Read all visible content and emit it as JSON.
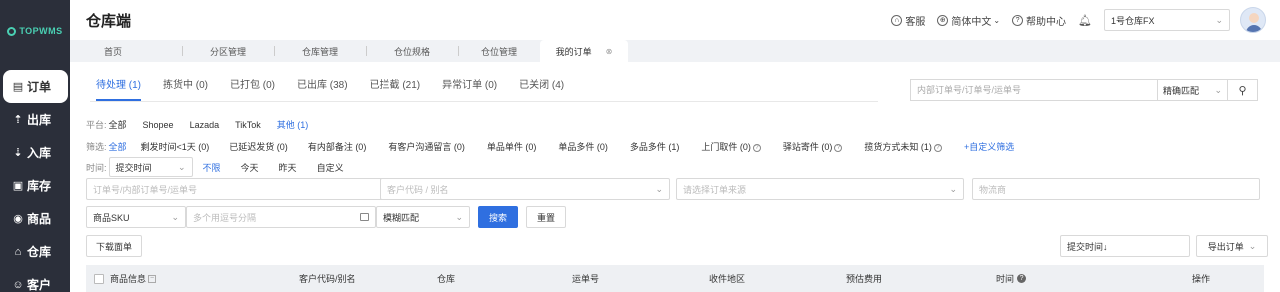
{
  "brand": {
    "logo_text": "TOPWMS",
    "accent": "#4ad0b3"
  },
  "sidebar": {
    "items": [
      {
        "label": "订单",
        "icon": "order-icon",
        "glyph": "▤",
        "active": true
      },
      {
        "label": "出库",
        "icon": "outbound-icon",
        "glyph": "⇡"
      },
      {
        "label": "入库",
        "icon": "inbound-icon",
        "glyph": "⇣"
      },
      {
        "label": "库存",
        "icon": "inventory-icon",
        "glyph": "▣"
      },
      {
        "label": "商品",
        "icon": "goods-icon",
        "glyph": "◉"
      },
      {
        "label": "仓库",
        "icon": "warehouse-icon",
        "glyph": "⌂"
      },
      {
        "label": "客户",
        "icon": "customer-icon",
        "glyph": "☺"
      }
    ]
  },
  "header": {
    "title": "仓库端",
    "service": "客服",
    "language": "简体中文",
    "help": "帮助中心",
    "warehouse": "1号仓库FX"
  },
  "page_tabs": [
    {
      "label": "首页"
    },
    {
      "label": "分区管理"
    },
    {
      "label": "仓库管理"
    },
    {
      "label": "仓位规格"
    },
    {
      "label": "仓位管理"
    },
    {
      "label": "我的订单",
      "active": true
    }
  ],
  "status_tabs": [
    {
      "label": "待处理 (1)",
      "active": true
    },
    {
      "label": "拣货中 (0)"
    },
    {
      "label": "已打包 (0)"
    },
    {
      "label": "已出库 (38)"
    },
    {
      "label": "已拦截 (21)"
    },
    {
      "label": "异常订单 (0)"
    },
    {
      "label": "已关闭 (4)"
    }
  ],
  "top_search": {
    "placeholder": "内部订单号/订单号/运单号",
    "match": "精确匹配"
  },
  "platform": {
    "label": "平台:",
    "options": [
      "全部",
      "Shopee",
      "Lazada",
      "TikTok",
      "其他 (1)"
    ],
    "selected_index": 4
  },
  "filter": {
    "label": "筛选:",
    "options": [
      {
        "text": "全部",
        "selected": true
      },
      {
        "text": "剩发时间<1天 (0)"
      },
      {
        "text": "已延迟发货 (0)"
      },
      {
        "text": "有内部备注 (0)"
      },
      {
        "text": "有客户沟通留言 (0)"
      },
      {
        "text": "单品单件 (0)"
      },
      {
        "text": "单品多件 (0)"
      },
      {
        "text": "多品多件 (1)"
      },
      {
        "text": "上门取件 (0)",
        "help": true
      },
      {
        "text": "驿站寄件 (0)",
        "help": true
      },
      {
        "text": "揽货方式未知 (1)",
        "help": true
      },
      {
        "text": "+自定义筛选",
        "selected": true
      }
    ]
  },
  "time": {
    "label": "时间:",
    "select": "提交时间",
    "options": [
      "不限",
      "今天",
      "昨天",
      "自定义"
    ],
    "selected_index": 0
  },
  "fields": {
    "order_no": "订单号/内部订单号/运单号",
    "customer": "客户代码 / 别名",
    "source": "请选择订单来源",
    "logistics": "物流商",
    "sku_select": "商品SKU",
    "sku_input": "多个用逗号分隔",
    "fuzzy": "模糊匹配"
  },
  "buttons": {
    "search": "搜索",
    "reset": "重置",
    "download": "下载面单",
    "sort": "提交时间↓",
    "export": "导出订单"
  },
  "table": {
    "columns": [
      "商品信息",
      "客户代码/别名",
      "仓库",
      "运单号",
      "收件地区",
      "预估费用",
      "时间",
      "操作"
    ]
  },
  "colors": {
    "primary": "#2f6fe0",
    "sidebar_bg": "#2b2f3a"
  }
}
